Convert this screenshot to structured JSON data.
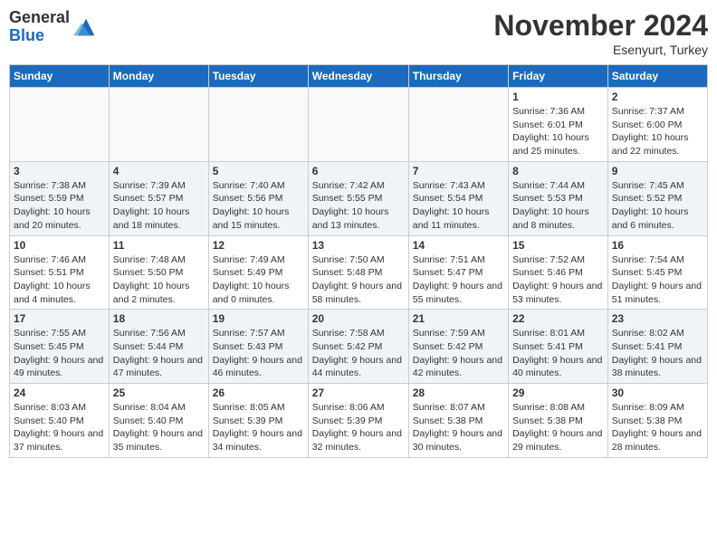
{
  "logo": {
    "general": "General",
    "blue": "Blue"
  },
  "title": "November 2024",
  "location": "Esenyurt, Turkey",
  "days_of_week": [
    "Sunday",
    "Monday",
    "Tuesday",
    "Wednesday",
    "Thursday",
    "Friday",
    "Saturday"
  ],
  "weeks": [
    [
      {
        "day": "",
        "info": ""
      },
      {
        "day": "",
        "info": ""
      },
      {
        "day": "",
        "info": ""
      },
      {
        "day": "",
        "info": ""
      },
      {
        "day": "",
        "info": ""
      },
      {
        "day": "1",
        "info": "Sunrise: 7:36 AM\nSunset: 6:01 PM\nDaylight: 10 hours and 25 minutes."
      },
      {
        "day": "2",
        "info": "Sunrise: 7:37 AM\nSunset: 6:00 PM\nDaylight: 10 hours and 22 minutes."
      }
    ],
    [
      {
        "day": "3",
        "info": "Sunrise: 7:38 AM\nSunset: 5:59 PM\nDaylight: 10 hours and 20 minutes."
      },
      {
        "day": "4",
        "info": "Sunrise: 7:39 AM\nSunset: 5:57 PM\nDaylight: 10 hours and 18 minutes."
      },
      {
        "day": "5",
        "info": "Sunrise: 7:40 AM\nSunset: 5:56 PM\nDaylight: 10 hours and 15 minutes."
      },
      {
        "day": "6",
        "info": "Sunrise: 7:42 AM\nSunset: 5:55 PM\nDaylight: 10 hours and 13 minutes."
      },
      {
        "day": "7",
        "info": "Sunrise: 7:43 AM\nSunset: 5:54 PM\nDaylight: 10 hours and 11 minutes."
      },
      {
        "day": "8",
        "info": "Sunrise: 7:44 AM\nSunset: 5:53 PM\nDaylight: 10 hours and 8 minutes."
      },
      {
        "day": "9",
        "info": "Sunrise: 7:45 AM\nSunset: 5:52 PM\nDaylight: 10 hours and 6 minutes."
      }
    ],
    [
      {
        "day": "10",
        "info": "Sunrise: 7:46 AM\nSunset: 5:51 PM\nDaylight: 10 hours and 4 minutes."
      },
      {
        "day": "11",
        "info": "Sunrise: 7:48 AM\nSunset: 5:50 PM\nDaylight: 10 hours and 2 minutes."
      },
      {
        "day": "12",
        "info": "Sunrise: 7:49 AM\nSunset: 5:49 PM\nDaylight: 10 hours and 0 minutes."
      },
      {
        "day": "13",
        "info": "Sunrise: 7:50 AM\nSunset: 5:48 PM\nDaylight: 9 hours and 58 minutes."
      },
      {
        "day": "14",
        "info": "Sunrise: 7:51 AM\nSunset: 5:47 PM\nDaylight: 9 hours and 55 minutes."
      },
      {
        "day": "15",
        "info": "Sunrise: 7:52 AM\nSunset: 5:46 PM\nDaylight: 9 hours and 53 minutes."
      },
      {
        "day": "16",
        "info": "Sunrise: 7:54 AM\nSunset: 5:45 PM\nDaylight: 9 hours and 51 minutes."
      }
    ],
    [
      {
        "day": "17",
        "info": "Sunrise: 7:55 AM\nSunset: 5:45 PM\nDaylight: 9 hours and 49 minutes."
      },
      {
        "day": "18",
        "info": "Sunrise: 7:56 AM\nSunset: 5:44 PM\nDaylight: 9 hours and 47 minutes."
      },
      {
        "day": "19",
        "info": "Sunrise: 7:57 AM\nSunset: 5:43 PM\nDaylight: 9 hours and 46 minutes."
      },
      {
        "day": "20",
        "info": "Sunrise: 7:58 AM\nSunset: 5:42 PM\nDaylight: 9 hours and 44 minutes."
      },
      {
        "day": "21",
        "info": "Sunrise: 7:59 AM\nSunset: 5:42 PM\nDaylight: 9 hours and 42 minutes."
      },
      {
        "day": "22",
        "info": "Sunrise: 8:01 AM\nSunset: 5:41 PM\nDaylight: 9 hours and 40 minutes."
      },
      {
        "day": "23",
        "info": "Sunrise: 8:02 AM\nSunset: 5:41 PM\nDaylight: 9 hours and 38 minutes."
      }
    ],
    [
      {
        "day": "24",
        "info": "Sunrise: 8:03 AM\nSunset: 5:40 PM\nDaylight: 9 hours and 37 minutes."
      },
      {
        "day": "25",
        "info": "Sunrise: 8:04 AM\nSunset: 5:40 PM\nDaylight: 9 hours and 35 minutes."
      },
      {
        "day": "26",
        "info": "Sunrise: 8:05 AM\nSunset: 5:39 PM\nDaylight: 9 hours and 34 minutes."
      },
      {
        "day": "27",
        "info": "Sunrise: 8:06 AM\nSunset: 5:39 PM\nDaylight: 9 hours and 32 minutes."
      },
      {
        "day": "28",
        "info": "Sunrise: 8:07 AM\nSunset: 5:38 PM\nDaylight: 9 hours and 30 minutes."
      },
      {
        "day": "29",
        "info": "Sunrise: 8:08 AM\nSunset: 5:38 PM\nDaylight: 9 hours and 29 minutes."
      },
      {
        "day": "30",
        "info": "Sunrise: 8:09 AM\nSunset: 5:38 PM\nDaylight: 9 hours and 28 minutes."
      }
    ]
  ]
}
